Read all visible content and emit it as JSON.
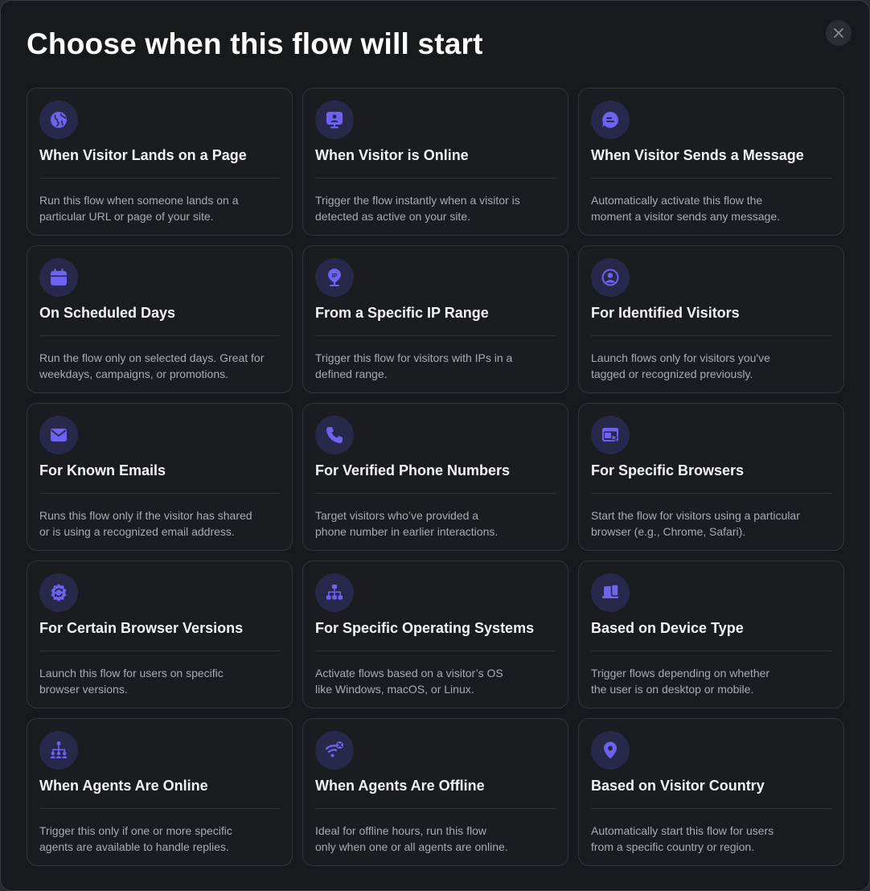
{
  "modal": {
    "title": "Choose when this flow will start",
    "close_icon": "close-icon"
  },
  "colors": {
    "accent": "#6e62f0",
    "icon_bg": "#28284a",
    "card_bg": "#1b1c20",
    "modal_bg": "#18191c"
  },
  "cards": [
    {
      "icon": "globe-icon",
      "title": "When Visitor Lands on a Page",
      "desc": [
        "Run this flow when someone lands on a",
        "particular URL or page of your site."
      ]
    },
    {
      "icon": "monitor-user-icon",
      "title": "When Visitor is Online",
      "desc": [
        "Trigger the flow instantly when a visitor is",
        "detected as active on your site."
      ]
    },
    {
      "icon": "chat-bubble-icon",
      "title": "When Visitor Sends a Message",
      "desc": [
        "Automatically activate this flow the",
        "moment a visitor sends any message."
      ]
    },
    {
      "icon": "calendar-icon",
      "title": "On Scheduled Days",
      "desc": [
        "Run the flow only on selected days. Great for",
        "weekdays, campaigns, or promotions."
      ]
    },
    {
      "icon": "ip-pin-icon",
      "title": "From a Specific IP Range",
      "desc": [
        "Trigger this flow for visitors with IPs in a",
        "defined range."
      ]
    },
    {
      "icon": "user-circle-icon",
      "title": "For Identified Visitors",
      "desc": [
        "Launch flows only for visitors you've",
        "tagged or recognized previously."
      ]
    },
    {
      "icon": "envelope-icon",
      "title": "For Known Emails",
      "desc": [
        "Runs this flow only if the visitor has shared",
        "or is using a recognized email address."
      ]
    },
    {
      "icon": "phone-icon",
      "title": "For Verified Phone Numbers",
      "desc": [
        "Target visitors who’ve provided a",
        "phone number in earlier interactions."
      ]
    },
    {
      "icon": "browser-window-icon",
      "title": "For Specific Browsers",
      "desc": [
        "Start the flow for visitors using a particular",
        "browser (e.g., Chrome, Safari)."
      ]
    },
    {
      "icon": "refresh-gear-icon",
      "title": "For Certain Browser Versions",
      "desc": [
        "Launch this flow for users on specific",
        "browser versions."
      ]
    },
    {
      "icon": "hierarchy-icon",
      "title": "For Specific Operating Systems",
      "desc": [
        "Activate flows based on a visitor’s OS",
        "like Windows, macOS, or Linux."
      ]
    },
    {
      "icon": "devices-icon",
      "title": "Based on Device Type",
      "desc": [
        "Trigger flows depending on whether",
        "the user is on desktop or mobile."
      ]
    },
    {
      "icon": "team-hierarchy-icon",
      "title": "When Agents Are Online",
      "desc": [
        "Trigger this only if one or more specific",
        "agents are available to handle replies."
      ]
    },
    {
      "icon": "wifi-off-icon",
      "title": "When Agents Are Offline",
      "desc": [
        "Ideal for offline hours, run this flow",
        "only when one or all agents are online."
      ]
    },
    {
      "icon": "location-pin-icon",
      "title": "Based on Visitor Country",
      "desc": [
        "Automatically start this flow for users",
        "from a specific country or region."
      ]
    }
  ]
}
